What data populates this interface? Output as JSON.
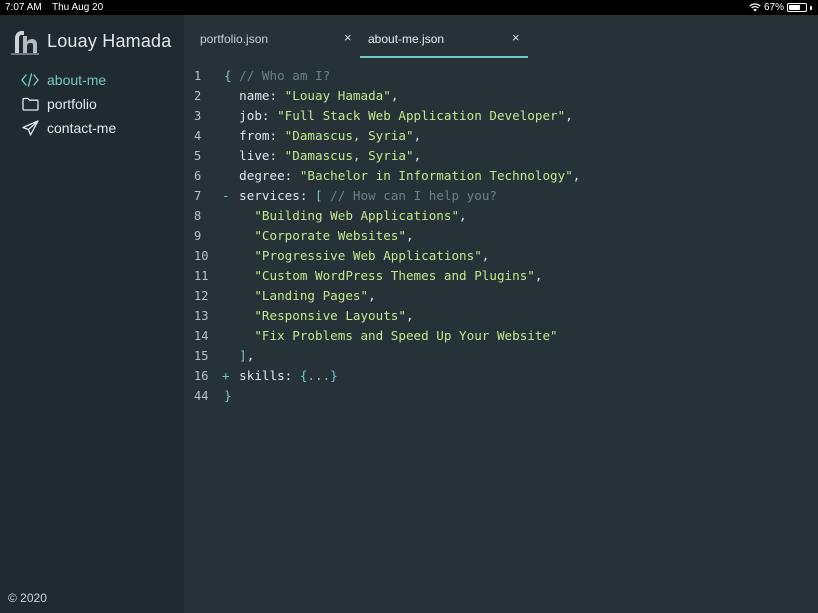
{
  "status": {
    "time": "7:07 AM",
    "date": "Thu Aug 20",
    "battery": "67%",
    "battery_level": 0.67
  },
  "sidebar": {
    "brand": "Louay Hamada",
    "items": [
      {
        "label": "about-me",
        "icon": "code-icon",
        "active": true
      },
      {
        "label": "portfolio",
        "icon": "folder-icon",
        "active": false
      },
      {
        "label": "contact-me",
        "icon": "paper-plane-icon",
        "active": false
      }
    ],
    "footer": "© 2020"
  },
  "tabs": [
    {
      "label": "portfolio.json",
      "close": "×",
      "active": false
    },
    {
      "label": "about-me.json",
      "close": "×",
      "active": true
    }
  ],
  "editor": {
    "lines": [
      {
        "num": "1",
        "fold": "",
        "tokens": [
          {
            "t": "{ ",
            "c": "p"
          },
          {
            "t": "// Who am I?",
            "c": "c"
          }
        ]
      },
      {
        "num": "2",
        "fold": "",
        "tokens": [
          {
            "t": "  name: ",
            "c": "k"
          },
          {
            "t": "\"Louay Hamada\"",
            "c": "s"
          },
          {
            "t": ",",
            "c": "k"
          }
        ]
      },
      {
        "num": "3",
        "fold": "",
        "tokens": [
          {
            "t": "  job: ",
            "c": "k"
          },
          {
            "t": "\"Full Stack Web Application Developer\"",
            "c": "s"
          },
          {
            "t": ",",
            "c": "k"
          }
        ]
      },
      {
        "num": "4",
        "fold": "",
        "tokens": [
          {
            "t": "  from: ",
            "c": "k"
          },
          {
            "t": "\"Damascus, Syria\"",
            "c": "s"
          },
          {
            "t": ",",
            "c": "k"
          }
        ]
      },
      {
        "num": "5",
        "fold": "",
        "tokens": [
          {
            "t": "  live: ",
            "c": "k"
          },
          {
            "t": "\"Damascus, Syria\"",
            "c": "s"
          },
          {
            "t": ",",
            "c": "k"
          }
        ]
      },
      {
        "num": "6",
        "fold": "",
        "tokens": [
          {
            "t": "  degree: ",
            "c": "k"
          },
          {
            "t": "\"Bachelor in Information Technology\"",
            "c": "s"
          },
          {
            "t": ",",
            "c": "k"
          }
        ]
      },
      {
        "num": "7",
        "fold": "-",
        "tokens": [
          {
            "t": "  services: ",
            "c": "k"
          },
          {
            "t": "[ ",
            "c": "p"
          },
          {
            "t": "// How can I help you?",
            "c": "c"
          }
        ]
      },
      {
        "num": "8",
        "fold": "",
        "tokens": [
          {
            "t": "    \"Building Web Applications\"",
            "c": "s"
          },
          {
            "t": ",",
            "c": "k"
          }
        ]
      },
      {
        "num": "9",
        "fold": "",
        "tokens": [
          {
            "t": "    \"Corporate Websites\"",
            "c": "s"
          },
          {
            "t": ",",
            "c": "k"
          }
        ]
      },
      {
        "num": "10",
        "fold": "",
        "tokens": [
          {
            "t": "    \"Progressive Web Applications\"",
            "c": "s"
          },
          {
            "t": ",",
            "c": "k"
          }
        ]
      },
      {
        "num": "11",
        "fold": "",
        "tokens": [
          {
            "t": "    \"Custom WordPress Themes and Plugins\"",
            "c": "s"
          },
          {
            "t": ",",
            "c": "k"
          }
        ]
      },
      {
        "num": "12",
        "fold": "",
        "tokens": [
          {
            "t": "    \"Landing Pages\"",
            "c": "s"
          },
          {
            "t": ",",
            "c": "k"
          }
        ]
      },
      {
        "num": "13",
        "fold": "",
        "tokens": [
          {
            "t": "    \"Responsive Layouts\"",
            "c": "s"
          },
          {
            "t": ",",
            "c": "k"
          }
        ]
      },
      {
        "num": "14",
        "fold": "",
        "tokens": [
          {
            "t": "    \"Fix Problems and Speed Up Your Website\"",
            "c": "s"
          }
        ]
      },
      {
        "num": "15",
        "fold": "",
        "tokens": [
          {
            "t": "  ]",
            "c": "p"
          },
          {
            "t": ",",
            "c": "k"
          }
        ]
      },
      {
        "num": "16",
        "fold": "+",
        "tokens": [
          {
            "t": "  skills: ",
            "c": "k"
          },
          {
            "t": "{...}",
            "c": "p"
          }
        ]
      },
      {
        "num": "44",
        "fold": "",
        "tokens": [
          {
            "t": "}",
            "c": "p"
          }
        ]
      }
    ]
  },
  "colors": {
    "accent": "#74c8c4",
    "string": "#c3e88d",
    "comment": "#6d7f88",
    "background": "#263238",
    "sidebar": "#1f2a31"
  }
}
